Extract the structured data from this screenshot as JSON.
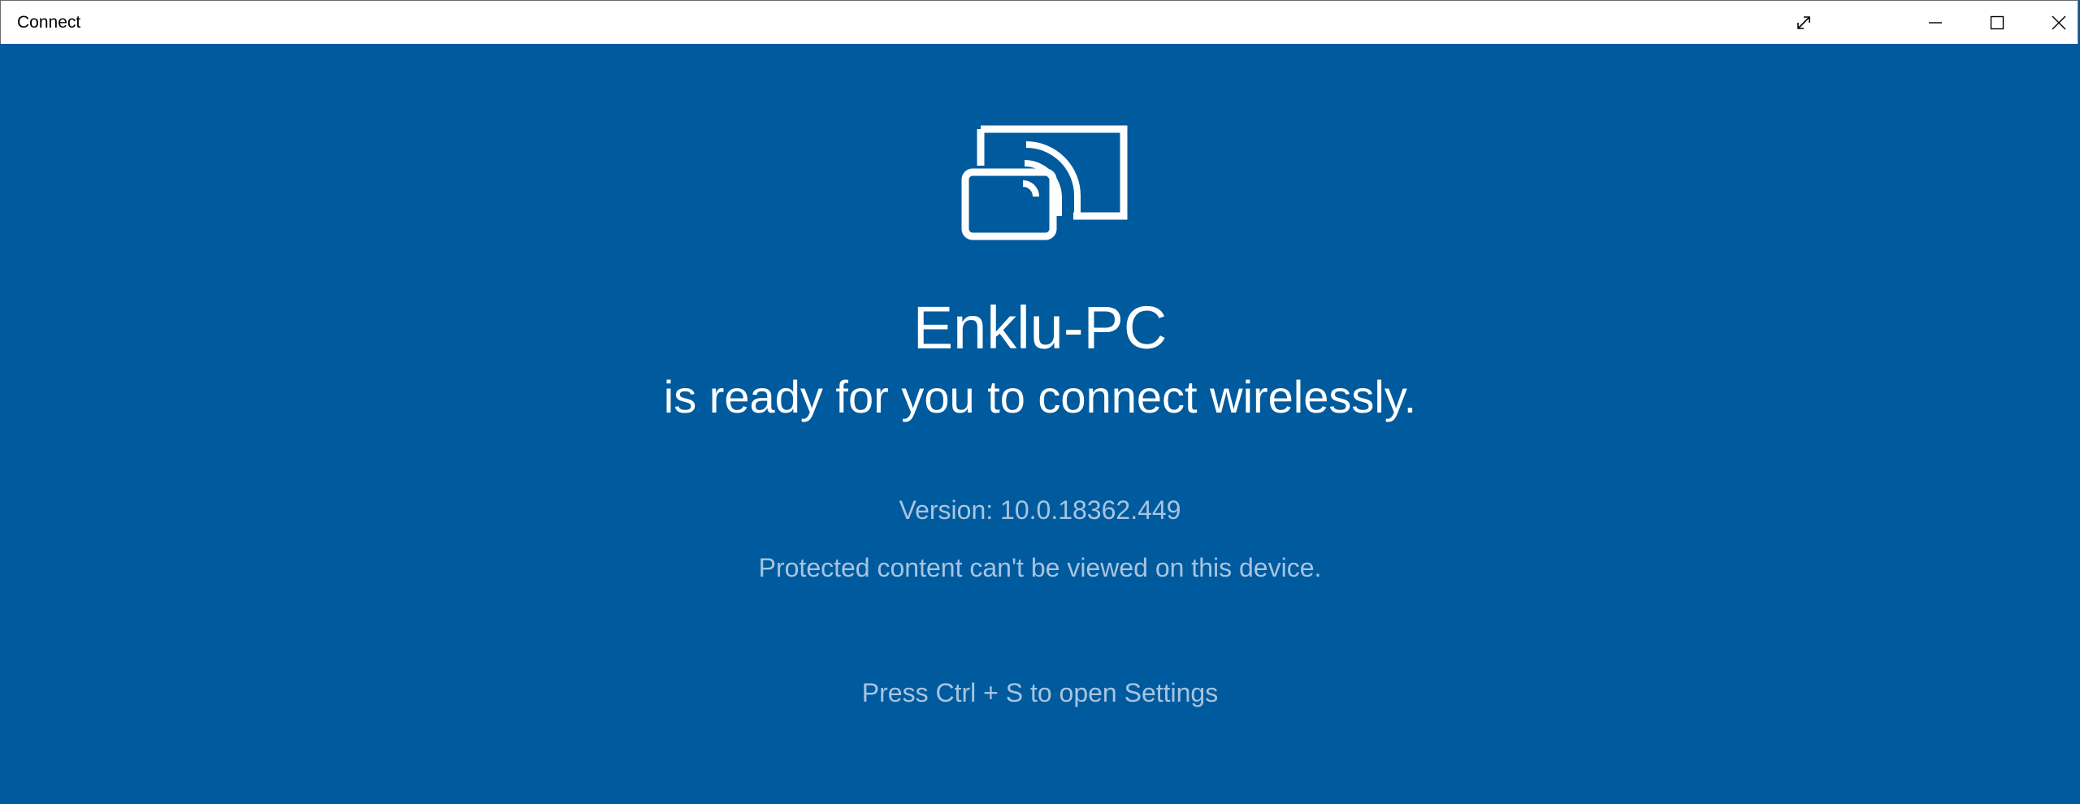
{
  "window": {
    "title": "Connect",
    "background_color": "#005a9e",
    "titlebar_color": "#ffffff"
  },
  "titlebar": {
    "buttons": [
      {
        "name": "fullscreen",
        "icon": "expand-icon"
      },
      {
        "name": "minimize",
        "icon": "minimize-icon"
      },
      {
        "name": "maximize",
        "icon": "maximize-icon"
      },
      {
        "name": "close",
        "icon": "close-icon"
      }
    ]
  },
  "main": {
    "icon": "wireless-display-icon",
    "device_name": "Enklu-PC",
    "ready_message": "is ready for you to connect wirelessly.",
    "version": "Version: 10.0.18362.449",
    "protected_notice": "Protected content can't be viewed on this device.",
    "settings_hint": "Press Ctrl + S to open Settings",
    "text_color": "#ffffff",
    "secondary_text_color": "#a8c4e0"
  }
}
